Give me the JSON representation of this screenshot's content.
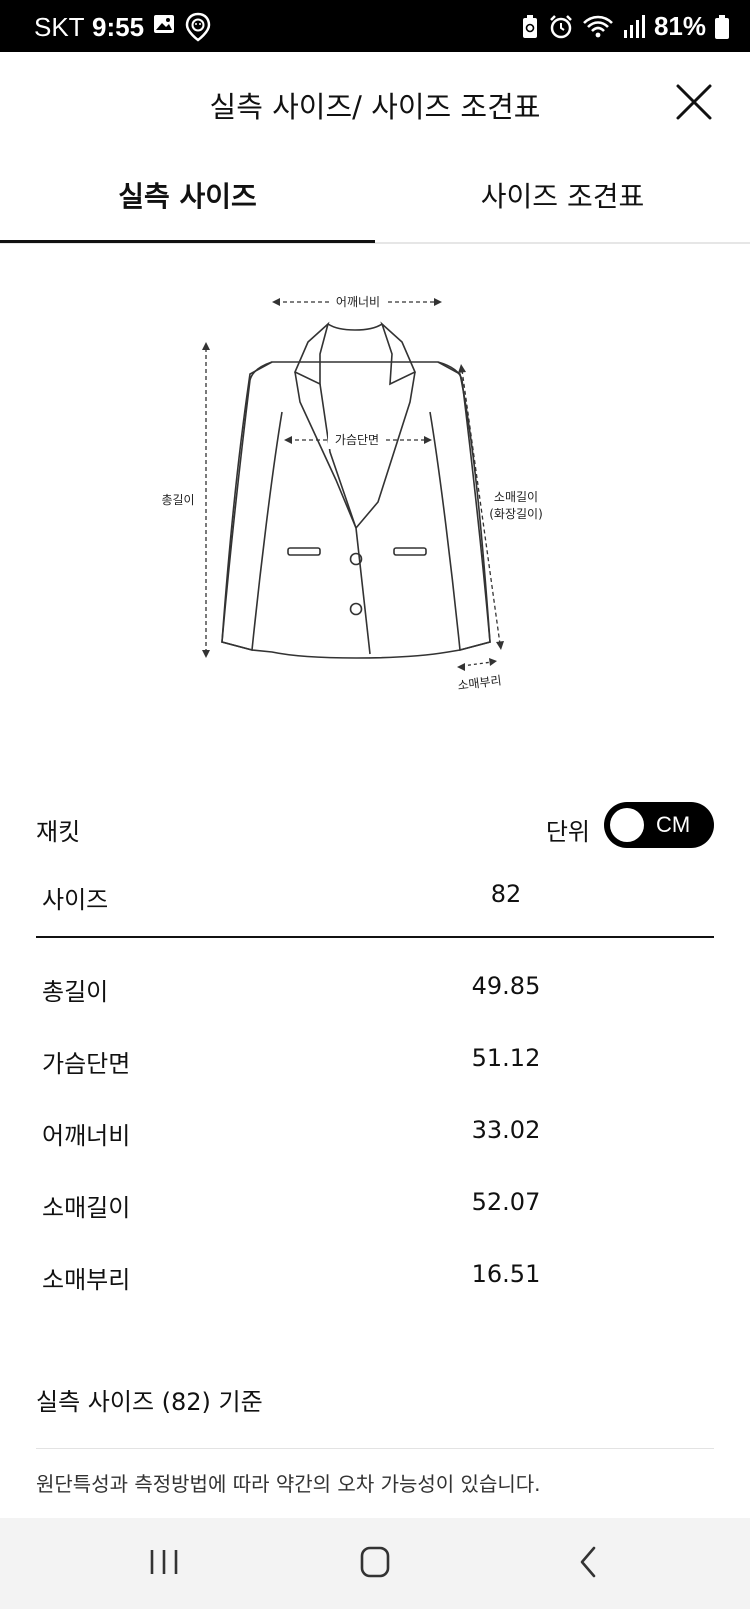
{
  "status_bar": {
    "carrier": "SKT",
    "time": "9:55",
    "battery_percent": "81%",
    "icons_left": [
      "gallery-icon",
      "location-badge-icon"
    ],
    "icons_right": [
      "recycle-icon",
      "alarm-icon",
      "wifi-icon",
      "signal-icon",
      "battery-icon"
    ]
  },
  "header": {
    "title": "실측 사이즈/ 사이즈 조견표",
    "close_icon": "close-icon"
  },
  "tabs": [
    {
      "label": "실측 사이즈",
      "active": true
    },
    {
      "label": "사이즈 조견표",
      "active": false
    }
  ],
  "diagram": {
    "labels": {
      "shoulder": "어깨너비",
      "chest": "가슴단면",
      "total_length": "총길이",
      "sleeve_length": "소매길이",
      "sleeve_length_sub": "(화장길이)",
      "cuff": "소매부리"
    }
  },
  "product": {
    "name": "재킷",
    "unit_label": "단위",
    "unit_value": "CM"
  },
  "table": {
    "header": {
      "label": "사이즈",
      "value": "82"
    },
    "rows": [
      {
        "label": "총길이",
        "value": "49.85"
      },
      {
        "label": "가슴단면",
        "value": "51.12"
      },
      {
        "label": "어깨너비",
        "value": "33.02"
      },
      {
        "label": "소매길이",
        "value": "52.07"
      },
      {
        "label": "소매부리",
        "value": "16.51"
      }
    ]
  },
  "notes": {
    "basis": "실측 사이즈 (82) 기준",
    "disclaimer": "원단특성과 측정방법에 따라 약간의 오차 가능성이 있습니다."
  },
  "nav_bar": {
    "buttons": [
      "recent-apps-icon",
      "home-icon",
      "back-icon"
    ]
  },
  "colors": {
    "accent": "#111111",
    "toggle_bg": "#000000",
    "nav_bg": "#f3f3f3"
  }
}
